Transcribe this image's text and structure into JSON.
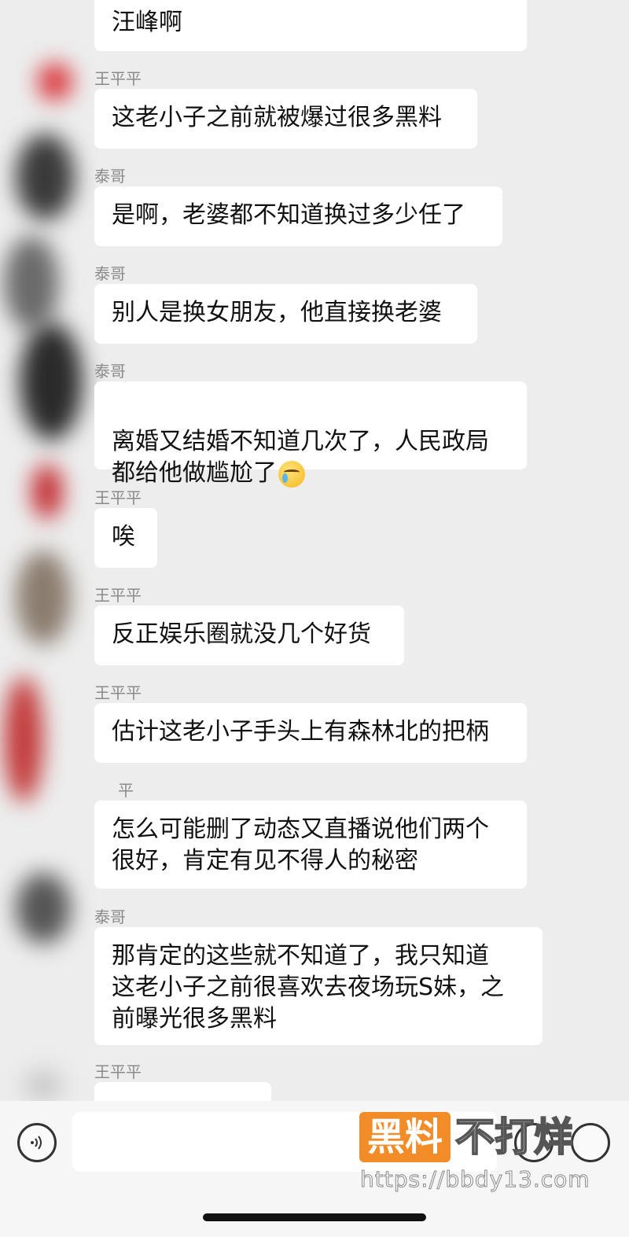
{
  "messages": [
    {
      "sender": "",
      "text": "汪峰啊"
    },
    {
      "sender": "王平平",
      "text": "这老小子之前就被爆过很多黑料"
    },
    {
      "sender": "泰哥",
      "text": "是啊，老婆都不知道换过多少任了"
    },
    {
      "sender": "泰哥",
      "text": "别人是换女朋友，他直接换老婆"
    },
    {
      "sender": "泰哥",
      "text": "离婚又结婚不知道几次了，人民政局\n都给他做尴尬了",
      "emoji": "crying-laughing-emoji"
    },
    {
      "sender": "王平平",
      "text": "唉"
    },
    {
      "sender": "王平平",
      "text": "反正娱乐圈就没几个好货"
    },
    {
      "sender": "王平平",
      "text": "估计这老小子手头上有森林北的把柄"
    },
    {
      "sender": "平",
      "text": "怎么可能删了动态又直播说他们两个\n很好，肯定有见不得人的秘密"
    },
    {
      "sender": "泰哥",
      "text": "那肯定的这些就不知道了，我只知道\n这老小子之前很喜欢去夜场玩S妹，之\n前曝光很多黑料"
    },
    {
      "sender": "王平平",
      "text": ""
    }
  ],
  "input_bar": {
    "voice_icon": "voice-icon",
    "emoji_icon": "emoji-icon",
    "plus_icon": "plus-icon"
  },
  "watermark": {
    "badge": "黑料",
    "text": "不打烊",
    "url": "https://bbdy13.com"
  },
  "colors": {
    "background": "#ededed",
    "bubble": "#ffffff",
    "watermark": "#f28c28"
  }
}
